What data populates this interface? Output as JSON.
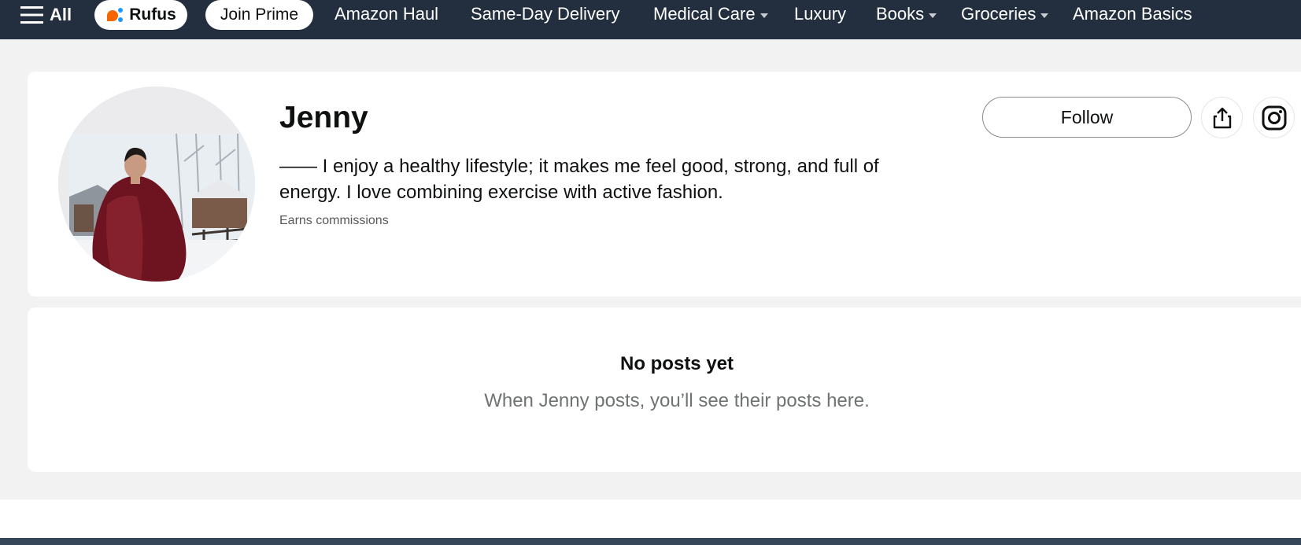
{
  "nav": {
    "all_label": "All",
    "rufus_label": "Rufus",
    "prime_label": "Join Prime",
    "links": [
      {
        "label": "Amazon Haul"
      },
      {
        "label": "Same-Day Delivery"
      },
      {
        "label": "Medical Care"
      },
      {
        "label": "Luxury"
      },
      {
        "label": "Books"
      },
      {
        "label": "Groceries"
      },
      {
        "label": "Amazon Basics"
      }
    ]
  },
  "profile": {
    "name": "Jenny",
    "bio": "—— I enjoy a healthy lifestyle; it makes me feel good, strong, and full of energy. I love combining exercise with active fashion.",
    "earns": "Earns commissions",
    "follow_label": "Follow"
  },
  "posts": {
    "empty_title": "No posts yet",
    "empty_subtitle": "When Jenny posts, you’ll see their posts here."
  },
  "colors": {
    "nav_bg": "#232f3e",
    "page_bg": "#f2f2f2",
    "rufus_orange": "#f56600",
    "rufus_blue": "#1a98ff",
    "coat": "#6d1420"
  },
  "icons": [
    "hamburger-icon",
    "rufus-icon",
    "chevron-down-icon",
    "share-icon",
    "instagram-icon"
  ]
}
